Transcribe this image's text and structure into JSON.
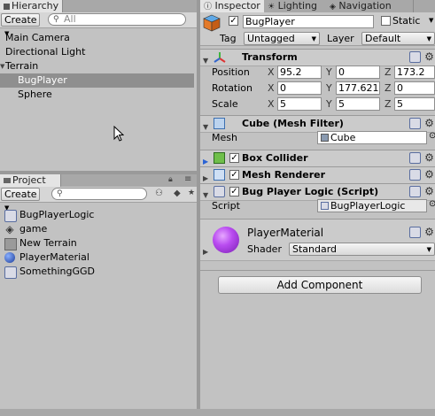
{
  "hierarchy": {
    "tab_label": "Hierarchy",
    "create_label": "Create",
    "search_placeholder": "All",
    "items": [
      {
        "label": "Main Camera"
      },
      {
        "label": "Directional Light"
      },
      {
        "label": "Terrain"
      },
      {
        "label": "BugPlayer",
        "selected": true
      },
      {
        "label": "Sphere"
      }
    ]
  },
  "project": {
    "tab_label": "Project",
    "create_label": "Create",
    "assets": [
      {
        "label": "BugPlayerLogic",
        "icon": "script-icon"
      },
      {
        "label": "game",
        "icon": "unity-scene-icon"
      },
      {
        "label": "New Terrain",
        "icon": "terrain-icon"
      },
      {
        "label": "PlayerMaterial",
        "icon": "material-sphere-icon"
      },
      {
        "label": "SomethingGGD",
        "icon": "script-icon"
      }
    ]
  },
  "tabs": {
    "inspector": "Inspector",
    "lighting": "Lighting",
    "navigation": "Navigation"
  },
  "inspector": {
    "object_name": "BugPlayer",
    "static_label": "Static",
    "tag_label": "Tag",
    "tag_value": "Untagged",
    "layer_label": "Layer",
    "layer_value": "Default",
    "transform": {
      "title": "Transform",
      "position_label": "Position",
      "rotation_label": "Rotation",
      "scale_label": "Scale",
      "position": {
        "x": "95.2",
        "y": "0",
        "z": "173.2"
      },
      "rotation": {
        "x": "0",
        "y": "177.621",
        "z": "0"
      },
      "scale": {
        "x": "5",
        "y": "5",
        "z": "5"
      },
      "axis_x": "X",
      "axis_y": "Y",
      "axis_z": "Z"
    },
    "mesh_filter": {
      "title": "Cube (Mesh Filter)",
      "mesh_label": "Mesh",
      "mesh_value": "Cube"
    },
    "box_collider": {
      "title": "Box Collider"
    },
    "mesh_renderer": {
      "title": "Mesh Renderer"
    },
    "script_component": {
      "title": "Bug Player Logic (Script)",
      "script_label": "Script",
      "script_value": "BugPlayerLogic"
    },
    "material": {
      "name": "PlayerMaterial",
      "shader_label": "Shader",
      "shader_value": "Standard"
    },
    "add_component_label": "Add Component"
  },
  "colors": {
    "selection": "#8f8f8f",
    "material_sphere": "#9b2fd6",
    "panel_bg": "#c2c2c2"
  }
}
